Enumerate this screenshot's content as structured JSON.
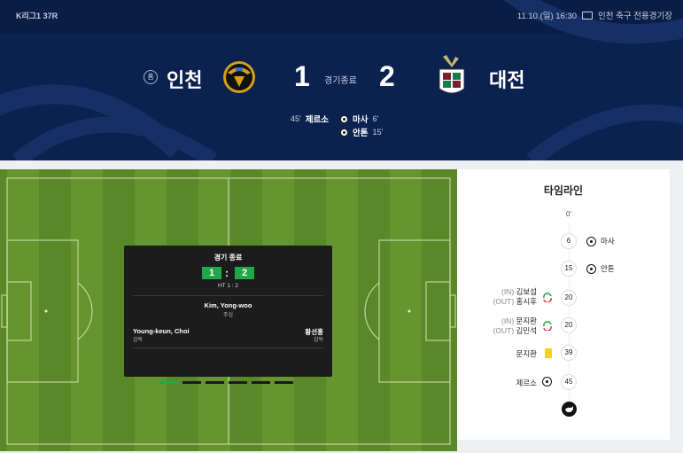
{
  "header": {
    "league": "K리그1 37R",
    "date": "11.10.(일) 16:30",
    "stadium": "인천 축구 전용경기장",
    "home_badge": "홈",
    "home_team": "인천",
    "away_team": "대전",
    "home_score": "1",
    "away_score": "2",
    "status": "경기종료"
  },
  "goals": {
    "home": [
      {
        "min": "45'",
        "player": "제르소"
      }
    ],
    "away": [
      {
        "player": "마사",
        "min": "6'"
      },
      {
        "player": "안톤",
        "min": "15'"
      }
    ]
  },
  "scoreboard": {
    "title": "경기 종료",
    "home": "1",
    "away": "2",
    "colon": ":",
    "ht": "HT 1 : 2",
    "referee": "Kim, Yong-woo",
    "referee_role": "주심",
    "home_coach": "Young-keun, Choi",
    "home_coach_role": "감독",
    "away_coach": "황선홍",
    "away_coach_role": "감독"
  },
  "timeline": {
    "title": "타임라인",
    "events": [
      {
        "min": "0'"
      },
      {
        "min": "6",
        "right": "마사"
      },
      {
        "min": "15",
        "right": "안톤"
      },
      {
        "min": "20",
        "in_tag": "(IN)",
        "in": "김보섭",
        "out_tag": "(OUT)",
        "out": "홍시후"
      },
      {
        "min": "20",
        "in_tag": "(IN)",
        "in": "문지환",
        "out_tag": "(OUT)",
        "out": "김민석"
      },
      {
        "min": "39",
        "left": "문지환"
      },
      {
        "min": "45",
        "left": "제르소"
      }
    ]
  },
  "colors": {
    "navy": "#0b2250",
    "green": "#1fa84a",
    "pitch": "#5e8a2c",
    "card": "#f4d21c"
  }
}
